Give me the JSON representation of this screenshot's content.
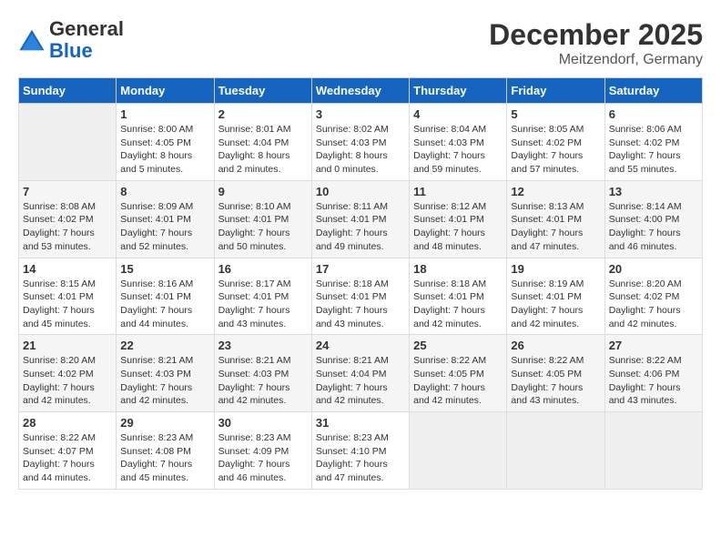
{
  "header": {
    "logo_line1": "General",
    "logo_line2": "Blue",
    "month_year": "December 2025",
    "location": "Meitzendorf, Germany"
  },
  "weekdays": [
    "Sunday",
    "Monday",
    "Tuesday",
    "Wednesday",
    "Thursday",
    "Friday",
    "Saturday"
  ],
  "weeks": [
    [
      {
        "day": "",
        "empty": true
      },
      {
        "day": "1",
        "sunrise": "8:00 AM",
        "sunset": "4:05 PM",
        "daylight": "8 hours and 5 minutes."
      },
      {
        "day": "2",
        "sunrise": "8:01 AM",
        "sunset": "4:04 PM",
        "daylight": "8 hours and 2 minutes."
      },
      {
        "day": "3",
        "sunrise": "8:02 AM",
        "sunset": "4:03 PM",
        "daylight": "8 hours and 0 minutes."
      },
      {
        "day": "4",
        "sunrise": "8:04 AM",
        "sunset": "4:03 PM",
        "daylight": "7 hours and 59 minutes."
      },
      {
        "day": "5",
        "sunrise": "8:05 AM",
        "sunset": "4:02 PM",
        "daylight": "7 hours and 57 minutes."
      },
      {
        "day": "6",
        "sunrise": "8:06 AM",
        "sunset": "4:02 PM",
        "daylight": "7 hours and 55 minutes."
      }
    ],
    [
      {
        "day": "7",
        "sunrise": "8:08 AM",
        "sunset": "4:02 PM",
        "daylight": "7 hours and 53 minutes."
      },
      {
        "day": "8",
        "sunrise": "8:09 AM",
        "sunset": "4:01 PM",
        "daylight": "7 hours and 52 minutes."
      },
      {
        "day": "9",
        "sunrise": "8:10 AM",
        "sunset": "4:01 PM",
        "daylight": "7 hours and 50 minutes."
      },
      {
        "day": "10",
        "sunrise": "8:11 AM",
        "sunset": "4:01 PM",
        "daylight": "7 hours and 49 minutes."
      },
      {
        "day": "11",
        "sunrise": "8:12 AM",
        "sunset": "4:01 PM",
        "daylight": "7 hours and 48 minutes."
      },
      {
        "day": "12",
        "sunrise": "8:13 AM",
        "sunset": "4:01 PM",
        "daylight": "7 hours and 47 minutes."
      },
      {
        "day": "13",
        "sunrise": "8:14 AM",
        "sunset": "4:00 PM",
        "daylight": "7 hours and 46 minutes."
      }
    ],
    [
      {
        "day": "14",
        "sunrise": "8:15 AM",
        "sunset": "4:01 PM",
        "daylight": "7 hours and 45 minutes."
      },
      {
        "day": "15",
        "sunrise": "8:16 AM",
        "sunset": "4:01 PM",
        "daylight": "7 hours and 44 minutes."
      },
      {
        "day": "16",
        "sunrise": "8:17 AM",
        "sunset": "4:01 PM",
        "daylight": "7 hours and 43 minutes."
      },
      {
        "day": "17",
        "sunrise": "8:18 AM",
        "sunset": "4:01 PM",
        "daylight": "7 hours and 43 minutes."
      },
      {
        "day": "18",
        "sunrise": "8:18 AM",
        "sunset": "4:01 PM",
        "daylight": "7 hours and 42 minutes."
      },
      {
        "day": "19",
        "sunrise": "8:19 AM",
        "sunset": "4:01 PM",
        "daylight": "7 hours and 42 minutes."
      },
      {
        "day": "20",
        "sunrise": "8:20 AM",
        "sunset": "4:02 PM",
        "daylight": "7 hours and 42 minutes."
      }
    ],
    [
      {
        "day": "21",
        "sunrise": "8:20 AM",
        "sunset": "4:02 PM",
        "daylight": "7 hours and 42 minutes."
      },
      {
        "day": "22",
        "sunrise": "8:21 AM",
        "sunset": "4:03 PM",
        "daylight": "7 hours and 42 minutes."
      },
      {
        "day": "23",
        "sunrise": "8:21 AM",
        "sunset": "4:03 PM",
        "daylight": "7 hours and 42 minutes."
      },
      {
        "day": "24",
        "sunrise": "8:21 AM",
        "sunset": "4:04 PM",
        "daylight": "7 hours and 42 minutes."
      },
      {
        "day": "25",
        "sunrise": "8:22 AM",
        "sunset": "4:05 PM",
        "daylight": "7 hours and 42 minutes."
      },
      {
        "day": "26",
        "sunrise": "8:22 AM",
        "sunset": "4:05 PM",
        "daylight": "7 hours and 43 minutes."
      },
      {
        "day": "27",
        "sunrise": "8:22 AM",
        "sunset": "4:06 PM",
        "daylight": "7 hours and 43 minutes."
      }
    ],
    [
      {
        "day": "28",
        "sunrise": "8:22 AM",
        "sunset": "4:07 PM",
        "daylight": "7 hours and 44 minutes."
      },
      {
        "day": "29",
        "sunrise": "8:23 AM",
        "sunset": "4:08 PM",
        "daylight": "7 hours and 45 minutes."
      },
      {
        "day": "30",
        "sunrise": "8:23 AM",
        "sunset": "4:09 PM",
        "daylight": "7 hours and 46 minutes."
      },
      {
        "day": "31",
        "sunrise": "8:23 AM",
        "sunset": "4:10 PM",
        "daylight": "7 hours and 47 minutes."
      },
      {
        "day": "",
        "empty": true
      },
      {
        "day": "",
        "empty": true
      },
      {
        "day": "",
        "empty": true
      }
    ]
  ],
  "labels": {
    "sunrise_prefix": "Sunrise: ",
    "sunset_prefix": "Sunset: ",
    "daylight_prefix": "Daylight: "
  }
}
